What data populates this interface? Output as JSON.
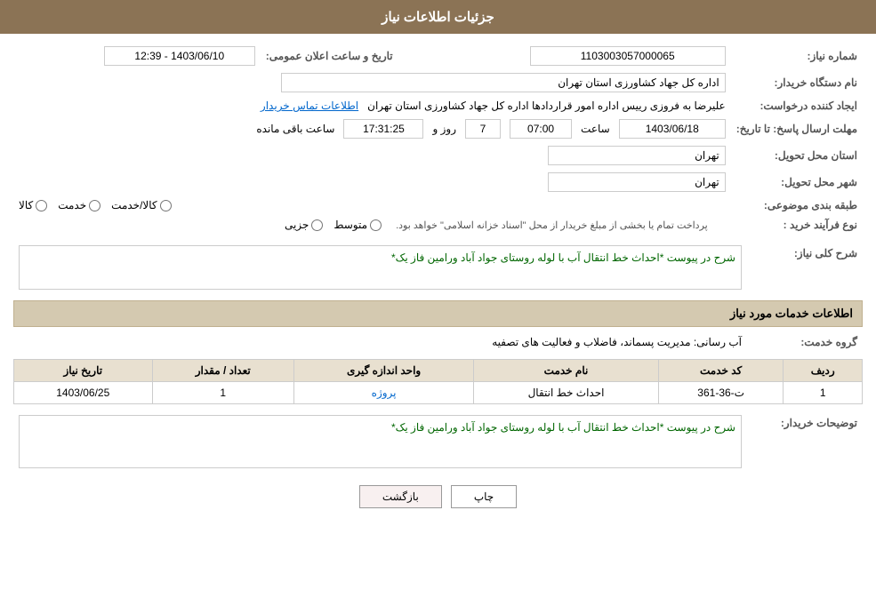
{
  "header": {
    "title": "جزئیات اطلاعات نیاز"
  },
  "fields": {
    "need_number_label": "شماره نیاز:",
    "need_number_value": "1103003057000065",
    "buyer_name_label": "نام دستگاه خریدار:",
    "buyer_name_value": "اداره کل جهاد کشاورزی استان تهران",
    "creator_label": "ایجاد کننده درخواست:",
    "creator_value": "علیرضا به فروزی رییس اداره امور قراردادها اداره کل جهاد کشاورزی استان تهران",
    "creator_link": "اطلاعات تماس خریدار",
    "response_date_label": "مهلت ارسال پاسخ: تا تاریخ:",
    "response_date": "1403/06/18",
    "response_time_label": "ساعت",
    "response_time": "07:00",
    "response_days_label": "روز و",
    "response_days": "7",
    "response_remaining_label": "ساعت باقی مانده",
    "response_remaining": "17:31:25",
    "province_label": "استان محل تحویل:",
    "province_value": "تهران",
    "city_label": "شهر محل تحویل:",
    "city_value": "تهران",
    "announce_date_label": "تاریخ و ساعت اعلان عمومی:",
    "announce_date_value": "1403/06/10 - 12:39",
    "subject_label": "طبقه بندی موضوعی:",
    "subject_radio1": "کالا",
    "subject_radio2": "خدمت",
    "subject_radio3": "کالا/خدمت",
    "purchase_type_label": "نوع فرآیند خرید :",
    "purchase_type_radio1": "جزیی",
    "purchase_type_radio2": "متوسط",
    "purchase_type_note": "پرداخت تمام یا بخشی از مبلغ خریدار از محل \"اسناد خزانه اسلامی\" خواهد بود.",
    "general_desc_label": "شرح کلی نیاز:",
    "general_desc_value": "شرح در پیوست *احداث خط انتقال آب با لوله روستای جواد آباد  ورامین فاز یک*",
    "services_section_title": "اطلاعات خدمات مورد نیاز",
    "service_group_label": "گروه خدمت:",
    "service_group_value": "آب رسانی: مدیریت پسماند، فاضلاب و فعالیت های تصفیه",
    "table_headers": [
      "ردیف",
      "کد خدمت",
      "نام خدمت",
      "واحد اندازه گیری",
      "تعداد / مقدار",
      "تاریخ نیاز"
    ],
    "table_rows": [
      {
        "row": "1",
        "code": "ت-36-361",
        "name": "احداث خط انتقال",
        "unit": "پروژه",
        "quantity": "1",
        "date": "1403/06/25"
      }
    ],
    "buyer_desc_label": "توضیحات خریدار:",
    "buyer_desc_value": "شرح در پیوست *احداث خط انتقال آب با لوله روستای جواد آباد  ورامین فاز یک*"
  },
  "buttons": {
    "print": "چاپ",
    "back": "بازگشت"
  }
}
